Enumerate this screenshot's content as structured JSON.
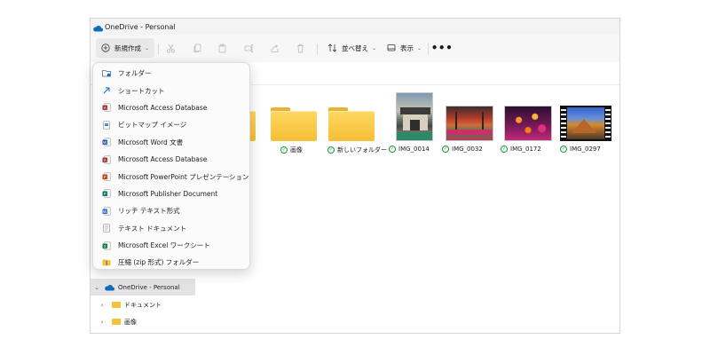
{
  "window": {
    "title": "OneDrive - Personal"
  },
  "toolbar": {
    "new_label": "新規作成",
    "sort_label": "並べ替え",
    "view_label": "表示",
    "more_label": "•••",
    "icons": [
      "cut-icon",
      "copy-icon",
      "paste-icon",
      "rename-icon",
      "share-icon",
      "delete-icon"
    ]
  },
  "files": [
    {
      "name": "",
      "kind": "folder",
      "synced": true
    },
    {
      "name": "画像",
      "kind": "folder",
      "synced": true
    },
    {
      "name": "新しいフォルダー",
      "kind": "folder",
      "synced": true
    },
    {
      "name": "IMG_0014",
      "kind": "photo",
      "synced": true
    },
    {
      "name": "IMG_0032",
      "kind": "photo",
      "synced": true
    },
    {
      "name": "IMG_0172",
      "kind": "photo",
      "synced": true
    },
    {
      "name": "IMG_0297",
      "kind": "video",
      "synced": true
    }
  ],
  "new_menu": {
    "items": [
      {
        "label": "フォルダー",
        "icon": "folder-icon"
      },
      {
        "label": "ショートカット",
        "icon": "shortcut-icon"
      },
      {
        "label": "Microsoft Access Database",
        "icon": "access-icon"
      },
      {
        "label": "ビットマップ イメージ",
        "icon": "bitmap-icon"
      },
      {
        "label": "Microsoft Word 文書",
        "icon": "word-icon"
      },
      {
        "label": "Microsoft Access Database",
        "icon": "access-icon"
      },
      {
        "label": "Microsoft PowerPoint プレゼンテーション",
        "icon": "powerpoint-icon"
      },
      {
        "label": "Microsoft Publisher Document",
        "icon": "publisher-icon"
      },
      {
        "label": "リッチ テキスト形式",
        "icon": "rtf-icon"
      },
      {
        "label": "テキスト ドキュメント",
        "icon": "text-icon"
      },
      {
        "label": "Microsoft Excel ワークシート",
        "icon": "excel-icon"
      },
      {
        "label": "圧縮 (zip 形式) フォルダー",
        "icon": "zip-folder-icon"
      }
    ]
  },
  "nav_pane": {
    "items": [
      {
        "label": "OneDrive - Personal",
        "expanded": true,
        "selected": true
      },
      {
        "label": "ドキュメント",
        "expanded": false
      },
      {
        "label": "画像",
        "expanded": false
      }
    ]
  },
  "colors": {
    "onedrive_blue": "#0f6cbd",
    "folder_yellow": "#f5bf35",
    "sync_green": "#1a9b3a",
    "access_red": "#a4373a",
    "word_blue": "#185abd",
    "powerpoint_orange": "#c43e1c",
    "publisher_teal": "#077568",
    "excel_green": "#107c41"
  }
}
